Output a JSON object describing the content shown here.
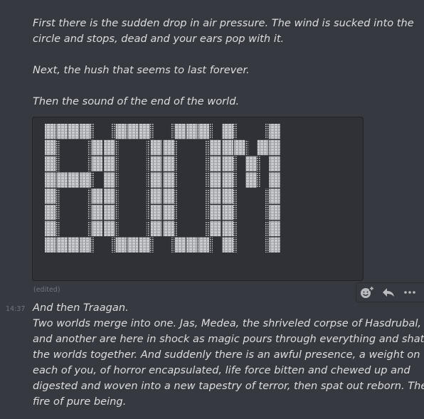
{
  "messages": {
    "first": {
      "lines": [
        "First there is the sudden drop in air pressure. The wind is sucked into the",
        "circle and stops, dead and your ears pop with it.",
        "Next, the hush that seems to last forever.",
        "Then the sound of the end of the world."
      ],
      "ascii_art": "BOOM",
      "edited_label": "(edited)"
    },
    "second": {
      "timestamp": "14:37",
      "lines": [
        "And then Traagan.",
        "Two worlds merge into one. Jas, Medea, the shriveled corpse of Hasdrubal,",
        "and another are here in shock as magic pours through everything and shatters",
        "the worlds together. And suddenly there is an awful presence, a weight on",
        "each of you, of horror encapsulated, life force bitten and chewed up and",
        "digested and woven into a new tapestry of terror, then spat out reborn. The",
        "fire of pure being."
      ]
    }
  },
  "toolbar": {
    "icons": [
      "add-reaction-icon",
      "reply-icon",
      "more-icon"
    ]
  },
  "colors": {
    "background": "#36393f",
    "text": "#dcddde",
    "muted": "#72767d",
    "codeblock": "#2f3136"
  }
}
